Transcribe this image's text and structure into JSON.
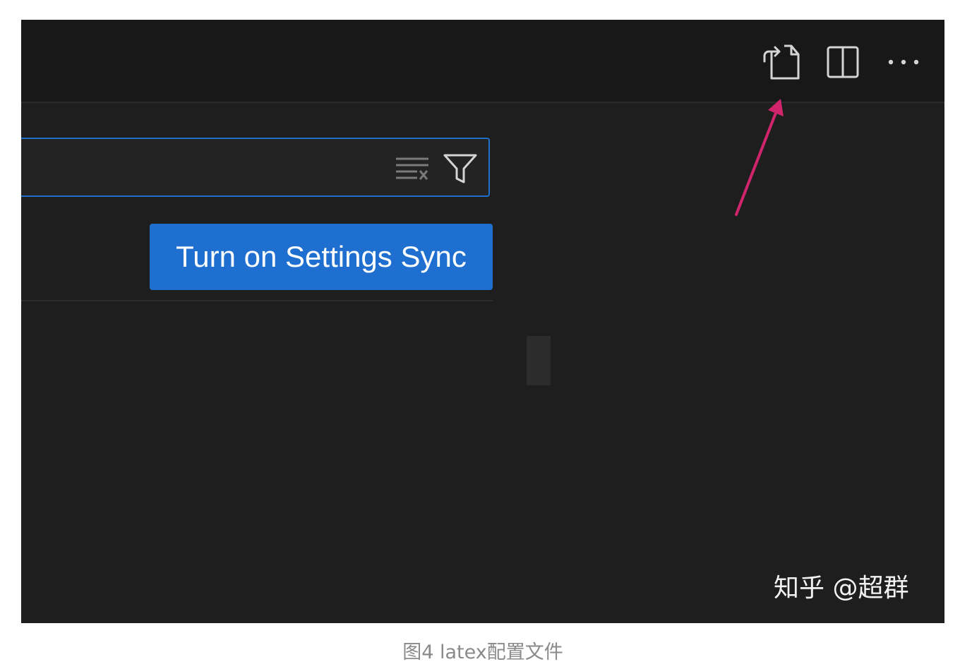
{
  "toolbar": {
    "icons": [
      "open-settings-json-icon",
      "split-editor-icon",
      "more-actions-icon"
    ]
  },
  "search": {
    "value": "",
    "placeholder": "",
    "clear_icon": "clear-filter-icon",
    "filter_icon": "filter-icon",
    "border_color": "#1f6fc6"
  },
  "sync": {
    "button_label": "Turn on Settings Sync",
    "button_color": "#1f6fd0"
  },
  "annotation": {
    "arrow_color": "#d0246d"
  },
  "watermark": {
    "text": "知乎 @超群"
  },
  "caption": {
    "text": "图4 latex配置文件"
  },
  "colors": {
    "editor_background": "#1e1e1e",
    "titlebar_background": "#181818"
  }
}
